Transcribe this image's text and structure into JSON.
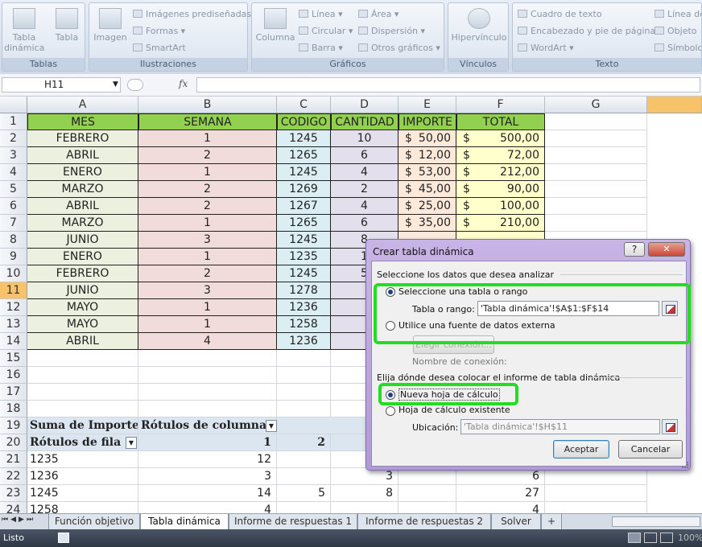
{
  "ribbon": {
    "groups": [
      {
        "label": "Tablas",
        "items": [
          "Tabla dinámica",
          "Tabla"
        ]
      },
      {
        "label": "Ilustraciones",
        "items": [
          "Imagen",
          "Imágenes prediseñadas",
          "Formas",
          "SmartArt"
        ]
      },
      {
        "label": "Gráficos",
        "items": [
          "Columna",
          "Línea",
          "Área",
          "Circular",
          "Dispersión",
          "Barra",
          "Otros gráficos"
        ]
      },
      {
        "label": "Vínculos",
        "items": [
          "Hipervínculo"
        ]
      },
      {
        "label": "Texto",
        "items": [
          "Cuadro de texto",
          "Encabezado y pie de página",
          "WordArt",
          "Línea de",
          "Objeto",
          "Símbolo"
        ]
      }
    ]
  },
  "formula_bar": {
    "name_box": "H11",
    "fx": "fx",
    "value": ""
  },
  "columns": [
    "A",
    "B",
    "C",
    "D",
    "E",
    "F",
    "G"
  ],
  "rows": [
    "1",
    "2",
    "3",
    "4",
    "5",
    "6",
    "7",
    "8",
    "9",
    "10",
    "11",
    "12",
    "13",
    "14",
    "15",
    "16",
    "17",
    "18",
    "19",
    "20",
    "21",
    "22",
    "23",
    "24"
  ],
  "table": {
    "headers": [
      "MES",
      "SEMANA",
      "CODIGO",
      "CANTIDAD",
      "IMPORTE",
      "TOTAL"
    ],
    "rows": [
      {
        "mes": "FEBRERO",
        "semana": "1",
        "codigo": "1245",
        "cantidad": "10",
        "importe": "50,00",
        "total": "500,00"
      },
      {
        "mes": "ABRIL",
        "semana": "2",
        "codigo": "1265",
        "cantidad": "6",
        "importe": "12,00",
        "total": "72,00"
      },
      {
        "mes": "ENERO",
        "semana": "1",
        "codigo": "1245",
        "cantidad": "4",
        "importe": "53,00",
        "total": "212,00"
      },
      {
        "mes": "MARZO",
        "semana": "2",
        "codigo": "1269",
        "cantidad": "2",
        "importe": "45,00",
        "total": "90,00"
      },
      {
        "mes": "ABRIL",
        "semana": "2",
        "codigo": "1267",
        "cantidad": "4",
        "importe": "25,00",
        "total": "100,00"
      },
      {
        "mes": "MARZO",
        "semana": "1",
        "codigo": "1265",
        "cantidad": "6",
        "importe": "35,00",
        "total": "210,00"
      },
      {
        "mes": "JUNIO",
        "semana": "3",
        "codigo": "1245",
        "cantidad": "8",
        "importe": "",
        "total": ""
      },
      {
        "mes": "ENERO",
        "semana": "1",
        "codigo": "1235",
        "cantidad": "1",
        "importe": "",
        "total": ""
      },
      {
        "mes": "FEBRERO",
        "semana": "2",
        "codigo": "1245",
        "cantidad": "5",
        "importe": "",
        "total": ""
      },
      {
        "mes": "JUNIO",
        "semana": "3",
        "codigo": "1278",
        "cantidad": "",
        "importe": "",
        "total": ""
      },
      {
        "mes": "MAYO",
        "semana": "1",
        "codigo": "1236",
        "cantidad": "",
        "importe": "",
        "total": ""
      },
      {
        "mes": "MAYO",
        "semana": "1",
        "codigo": "1258",
        "cantidad": "",
        "importe": "",
        "total": ""
      },
      {
        "mes": "ABRIL",
        "semana": "4",
        "codigo": "1236",
        "cantidad": "",
        "importe": "",
        "total": ""
      }
    ],
    "currency": "$"
  },
  "pivot": {
    "sum_label": "Suma de Importe",
    "col_labels": "Rótulos de columna",
    "row_labels": "Rótulos de fila",
    "col_headers": [
      "1",
      "2"
    ],
    "rows": [
      {
        "label": "1235",
        "c1": "12",
        "c2": "",
        "c3": "",
        "total": ""
      },
      {
        "label": "1236",
        "c1": "3",
        "c2": "",
        "c3": "3",
        "total": "6"
      },
      {
        "label": "1245",
        "c1": "14",
        "c2": "5",
        "c3": "8",
        "total": "27"
      },
      {
        "label": "1258",
        "c1": "4",
        "c2": "",
        "c3": "",
        "total": "4"
      }
    ]
  },
  "dialog": {
    "title": "Crear tabla dinámica",
    "help": "?",
    "close": "✕",
    "section1": "Seleccione los datos que desea analizar",
    "opt_range": "Seleccione una tabla o rango",
    "range_label": "Tabla o rango:",
    "range_value": "'Tabla dinámica'!$A$1:$F$14",
    "opt_external": "Utilice una fuente de datos externa",
    "choose_conn": "Elegir conexión...",
    "conn_name": "Nombre de conexión:",
    "section2": "Elija dónde desea colocar el informe de tabla dinámica",
    "opt_new": "Nueva hoja de cálculo",
    "opt_existing": "Hoja de cálculo existente",
    "location_label": "Ubicación:",
    "location_value": "'Tabla dinámica'!$H$11",
    "ok": "Aceptar",
    "cancel": "Cancelar"
  },
  "sheet_tabs": [
    "Función objetivo",
    "Tabla dinámica",
    "Informe de respuestas 1",
    "Informe de respuestas 2",
    "Solver"
  ],
  "active_tab": "Tabla dinámica",
  "status": {
    "text": "Listo",
    "zoom": "100%"
  },
  "colors": {
    "header_green": "#92d050",
    "mes_bg": "#ebf1de",
    "semana_bg": "#f2dcdb",
    "codigo_bg": "#dbeef4",
    "cantidad_bg": "#e4dfec",
    "importe_bg": "#fde9d9",
    "total_bg": "#ffffcc",
    "highlight": "#22dd22",
    "dialog_frame": "#b39ad8"
  }
}
